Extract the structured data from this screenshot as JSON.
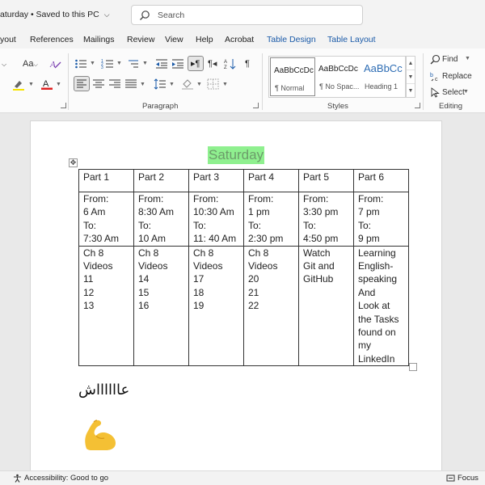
{
  "titlebar": {
    "doc_title": "aturday",
    "saved_status": "Saved to this PC",
    "search_placeholder": "Search"
  },
  "tabs": [
    {
      "label": "yout"
    },
    {
      "label": "References"
    },
    {
      "label": "Mailings"
    },
    {
      "label": "Review"
    },
    {
      "label": "View"
    },
    {
      "label": "Help"
    },
    {
      "label": "Acrobat"
    },
    {
      "label": "Table Design"
    },
    {
      "label": "Table Layout"
    }
  ],
  "ribbon": {
    "font_size_label": "Aa",
    "paragraph_label": "Paragraph",
    "styles_label": "Styles",
    "editing_label": "Editing",
    "styles": [
      {
        "preview": "AaBbCcDc",
        "name": "¶ Normal"
      },
      {
        "preview": "AaBbCcDc",
        "name": "¶ No Spac..."
      },
      {
        "preview": "AaBbCc",
        "name": "Heading 1"
      }
    ],
    "find_label": "Find",
    "replace_label": "Replace",
    "select_label": "Select"
  },
  "document": {
    "heading": "Saturday",
    "table": {
      "headers": [
        "Part 1",
        "Part 2",
        "Part 3",
        "Part 4",
        "Part 5",
        "Part 6"
      ],
      "times": [
        [
          "From:",
          "6 Am",
          "To:",
          "7:30 Am"
        ],
        [
          "From:",
          "8:30 Am",
          "To:",
          "10 Am"
        ],
        [
          "From:",
          "10:30 Am",
          "To:",
          "11: 40 Am"
        ],
        [
          "From:",
          "1 pm",
          "To:",
          "2:30 pm"
        ],
        [
          "From:",
          "3:30 pm",
          "To:",
          "4:50 pm"
        ],
        [
          "From:",
          "7 pm",
          "To:",
          "9 pm"
        ]
      ],
      "tasks": [
        [
          "Ch 8",
          "Videos",
          "11",
          "12",
          "13"
        ],
        [
          "Ch 8",
          "Videos",
          "14",
          "15",
          "16"
        ],
        [
          "Ch 8",
          "Videos",
          "17",
          "18",
          "19"
        ],
        [
          "Ch 8",
          "Videos",
          "20",
          "21",
          "22"
        ],
        [
          "Watch",
          "Git and",
          "GitHub"
        ],
        [
          "Learning",
          "English-",
          "speaking",
          "And",
          "Look at",
          "the Tasks",
          "found on",
          "my",
          "LinkedIn"
        ]
      ]
    },
    "arabic_text": "عااااااش",
    "emoji_icon": "flexed-biceps-icon"
  },
  "statusbar": {
    "accessibility": "Accessibility: Good to go",
    "focus": "Focus"
  },
  "colors": {
    "heading_highlight": "#8ff08f",
    "heading_text": "#6c9c6a",
    "contextual_tab": "#1a5aa8",
    "emoji": "#f4c034"
  }
}
